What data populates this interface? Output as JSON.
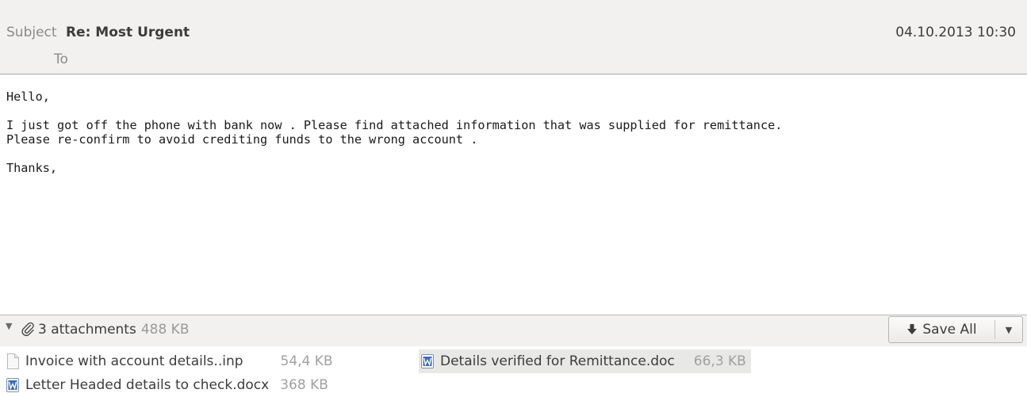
{
  "header": {
    "subject_label": "Subject",
    "subject_value": "Re: Most Urgent",
    "date": "04.10.2013 10:30",
    "to_label": "To"
  },
  "message": {
    "lines": [
      "Hello,",
      "",
      "I just got off the phone with bank now . Please find attached information that was supplied for remittance.",
      "Please re-confirm to avoid crediting funds to the wrong account .",
      "",
      "Thanks,"
    ]
  },
  "attachments_bar": {
    "toggle_icon": "triangle-down-icon",
    "clip_icon": "paperclip-icon",
    "summary": "3 attachments",
    "total_size": "488 KB",
    "save_all_label": "Save All",
    "save_all_icon": "arrow-down-icon",
    "dropdown_icon": "chevron-down-icon"
  },
  "attachments": [
    {
      "name": "Invoice with account details..inp",
      "size": "54,4 KB",
      "icon": "generic-file-icon",
      "selected": false
    },
    {
      "name": "Details verified for Remittance.doc",
      "size": "66,3 KB",
      "icon": "word-doc-icon",
      "selected": true
    },
    {
      "name": "Letter Headed details to check.docx",
      "size": "368 KB",
      "icon": "word-doc-icon",
      "selected": false
    }
  ],
  "colors": {
    "header_bg": "#f2f1f0",
    "label_gray": "#8a8a8a",
    "text": "#3c3c3c",
    "word_icon_blue": "#3f6db5"
  }
}
